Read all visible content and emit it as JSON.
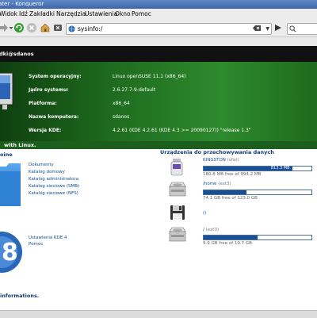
{
  "window": {
    "title": "ater - Konqueror"
  },
  "menubar": {
    "items": [
      "Widok",
      "Idź",
      "Zakładki",
      "Narzędzia",
      "Ustawienia",
      "Okno",
      "Pomoc"
    ]
  },
  "toolbar": {
    "url": "sysinfo:/"
  },
  "header": {
    "user": "dki@sdanos"
  },
  "system": {
    "rows": [
      {
        "label": "System operacyjny:",
        "value": "Linux openSUSE 11.1 (x86_64)"
      },
      {
        "label": "Jądro systemu:",
        "value": "2.6.27.7-9-default"
      },
      {
        "label": "Platforma:",
        "value": "x86_64"
      },
      {
        "label": "Nazwa komputera:",
        "value": "sdanos"
      },
      {
        "label": "Wersja KDE:",
        "value": "4.2.61 (KDE 4.2.61 (KDE 4.3 >= 20090127)) \"release 1.3\""
      }
    ]
  },
  "tagline": "with Linux.",
  "left": {
    "heading": "oine",
    "links": [
      "Dokumenty",
      "Katalog domowy",
      "Katalog administratora",
      "Katalog sieciowe (SMB)",
      "Katalog sieciowe (NFS)"
    ],
    "kde_links": [
      "Ustawienia KDE 4",
      "Pomoc"
    ]
  },
  "devices": {
    "heading": "Urządzenia do przechowywania danych",
    "items": [
      {
        "name": "KINGSTON",
        "fs": "(vfat)",
        "bar_text": "813.3 MB",
        "used_fraction": 0.82,
        "free": "180.8 MB free of 994.2 MB",
        "icon": "usb-drive-icon"
      },
      {
        "name": "/home",
        "fs": "(ext3)",
        "bar_text": "",
        "used_fraction": 0.4,
        "free": "74.1 GB free of 123.0 GB",
        "icon": "hard-disk-icon"
      },
      {
        "name": "()",
        "fs": "",
        "bar_text": "",
        "used_fraction": null,
        "free": "",
        "icon": "floppy-disk-icon"
      },
      {
        "name": "/",
        "fs": "(ext3)",
        "bar_text": "",
        "used_fraction": 0.5,
        "free": "9.9 GB free of 19.7 GB",
        "icon": "hard-disk-icon"
      }
    ]
  },
  "footer": {
    "text": "informations."
  },
  "colors": {
    "green": "#2d8a2d",
    "link": "#0b4e8e",
    "heading": "#0c3c70",
    "bar": "#1b4f94"
  }
}
